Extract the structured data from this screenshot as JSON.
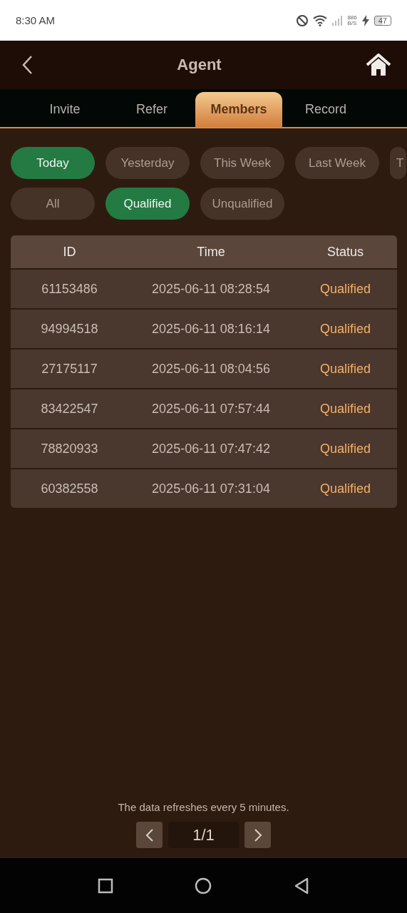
{
  "status_bar": {
    "time": "8:30 AM",
    "net_speed": "886",
    "net_unit": "B/S",
    "battery": "47"
  },
  "header": {
    "title": "Agent"
  },
  "tabs": [
    {
      "label": "Invite",
      "selected": false
    },
    {
      "label": "Refer",
      "selected": false
    },
    {
      "label": "Members",
      "selected": true
    },
    {
      "label": "Record",
      "selected": false
    }
  ],
  "period_filters": [
    {
      "label": "Today",
      "selected": true
    },
    {
      "label": "Yesterday",
      "selected": false
    },
    {
      "label": "This Week",
      "selected": false
    },
    {
      "label": "Last Week",
      "selected": false
    },
    {
      "label": "T",
      "selected": false
    }
  ],
  "status_filters": [
    {
      "label": "All",
      "selected": false
    },
    {
      "label": "Qualified",
      "selected": true
    },
    {
      "label": "Unqualified",
      "selected": false
    }
  ],
  "table": {
    "columns": [
      "ID",
      "Time",
      "Status"
    ],
    "rows": [
      [
        "61153486",
        "2025-06-11 08:28:54",
        "Qualified"
      ],
      [
        "94994518",
        "2025-06-11 08:16:14",
        "Qualified"
      ],
      [
        "27175117",
        "2025-06-11 08:04:56",
        "Qualified"
      ],
      [
        "83422547",
        "2025-06-11 07:57:44",
        "Qualified"
      ],
      [
        "78820933",
        "2025-06-11 07:47:42",
        "Qualified"
      ],
      [
        "60382558",
        "2025-06-11 07:31:04",
        "Qualified"
      ]
    ]
  },
  "note": "The data refreshes every 5 minutes.",
  "pager": {
    "page": "1/1"
  }
}
